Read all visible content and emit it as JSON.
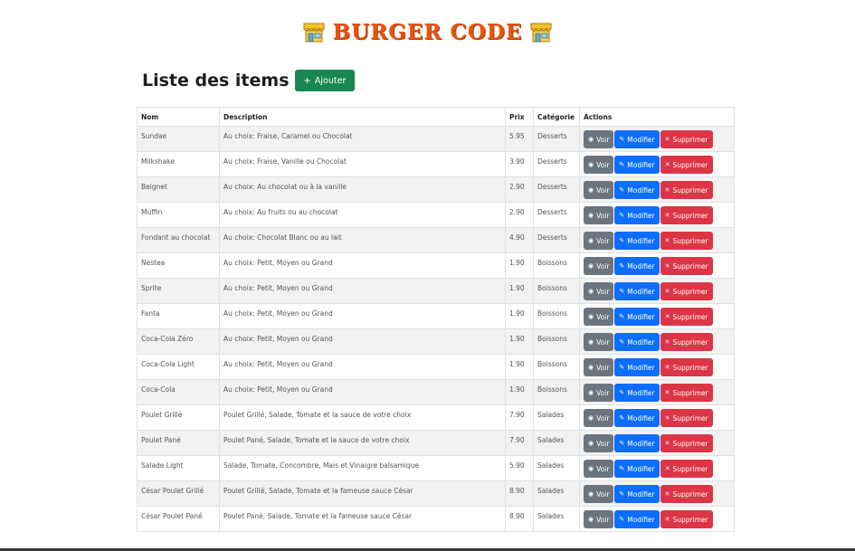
{
  "header": {
    "brand": "BURGER CODE",
    "brand_icon": "shop-icon"
  },
  "page": {
    "title": "Liste des items",
    "add_label": "Ajouter"
  },
  "table": {
    "headers": [
      "Nom",
      "Description",
      "Prix",
      "Catégorie",
      "Actions"
    ],
    "action_labels": {
      "view": "Voir",
      "edit": "Modifier",
      "delete": "Supprimer"
    },
    "rows": [
      {
        "name": "Sundae",
        "description": "Au choix: Fraise, Caramel ou Chocolat",
        "price": "5.95",
        "category": "Desserts"
      },
      {
        "name": "Milkshake",
        "description": "Au choix: Fraise, Vanille ou Chocolat",
        "price": "3.90",
        "category": "Desserts"
      },
      {
        "name": "Beignet",
        "description": "Au choix: Au chocolat ou à la vanille",
        "price": "2.90",
        "category": "Desserts"
      },
      {
        "name": "Muffin",
        "description": "Au choix: Au fruits ou au chocolat",
        "price": "2.90",
        "category": "Desserts"
      },
      {
        "name": "Fondant au chocolat",
        "description": "Au choix: Chocolat Blanc ou au lait",
        "price": "4.90",
        "category": "Desserts"
      },
      {
        "name": "Nestea",
        "description": "Au choix: Petit, Moyen ou Grand",
        "price": "1.90",
        "category": "Boissons"
      },
      {
        "name": "Sprite",
        "description": "Au choix: Petit, Moyen ou Grand",
        "price": "1.90",
        "category": "Boissons"
      },
      {
        "name": "Fanta",
        "description": "Au choix: Petit, Moyen ou Grand",
        "price": "1.90",
        "category": "Boissons"
      },
      {
        "name": "Coca-Cola Zéro",
        "description": "Au choix: Petit, Moyen ou Grand",
        "price": "1.90",
        "category": "Boissons"
      },
      {
        "name": "Coca-Cola Light",
        "description": "Au choix: Petit, Moyen ou Grand",
        "price": "1.90",
        "category": "Boissons"
      },
      {
        "name": "Coca-Cola",
        "description": "Au choix: Petit, Moyen ou Grand",
        "price": "1.90",
        "category": "Boissons"
      },
      {
        "name": "Poulet Grillé",
        "description": "Poulet Grillé, Salade, Tomate et la sauce de votre choix",
        "price": "7.90",
        "category": "Salades"
      },
      {
        "name": "Poulet Pané",
        "description": "Poulet Pané, Salade, Tomate et la sauce de votre choix",
        "price": "7.90",
        "category": "Salades"
      },
      {
        "name": "Salade Light",
        "description": "Salade, Tomate, Concombre, Mais et Vinaigre balsamique",
        "price": "5.90",
        "category": "Salades"
      },
      {
        "name": "César Poulet Grillé",
        "description": "Poulet Grillé, Salade, Tomate et la fameuse sauce César",
        "price": "8.90",
        "category": "Salades"
      },
      {
        "name": "César Poulet Pané",
        "description": "Poulet Pané, Salade, Tomate et la fameuse sauce César",
        "price": "8.90",
        "category": "Salades"
      }
    ]
  },
  "colors": {
    "brand": "#e7540d",
    "success": "#198754",
    "secondary": "#6c757d",
    "primary": "#0d6efd",
    "danger": "#dc3545"
  }
}
